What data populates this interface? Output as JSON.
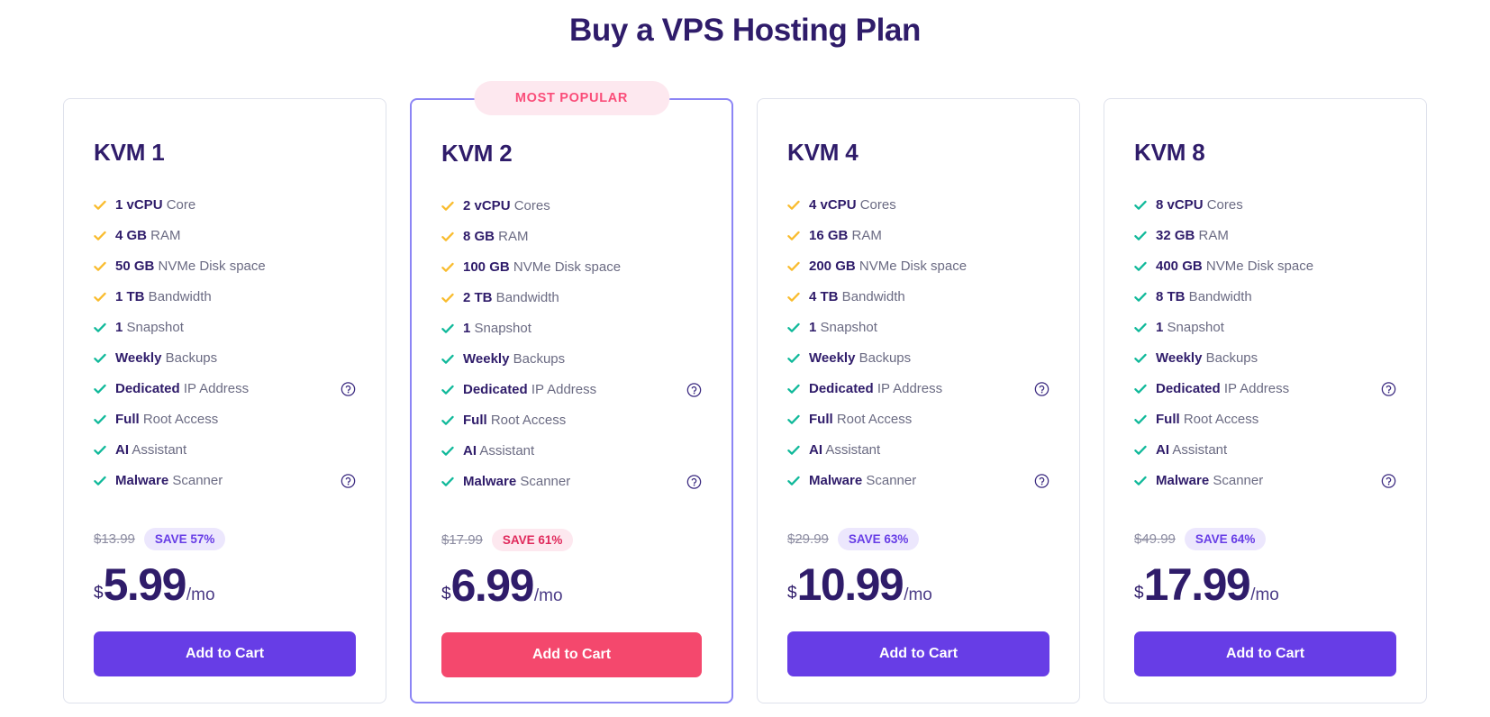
{
  "header": {
    "title": "Buy a VPS Hosting Plan"
  },
  "colors": {
    "title": "#2f1c6a",
    "accent_purple": "#673de6",
    "accent_pink": "#f4486d",
    "check_amber": "#f9bc2e",
    "check_teal": "#10b99a",
    "badge_purple_bg": "#ece7fd",
    "badge_pink_bg": "#fde8ef",
    "card_border": "#dfe2ec",
    "featured_border": "#8c85f5"
  },
  "icons": {
    "check": "check-icon",
    "help": "help-circle-icon"
  },
  "labels": {
    "add_to_cart": "Add to Cart",
    "most_popular": "MOST POPULAR",
    "currency_symbol": "$",
    "period": "/mo"
  },
  "plans": [
    {
      "name": "KVM 1",
      "featured": false,
      "badge": null,
      "features": [
        {
          "strong": "1 vCPU",
          "rest": " Core",
          "check": "amber",
          "help": false
        },
        {
          "strong": "4 GB",
          "rest": " RAM",
          "check": "amber",
          "help": false
        },
        {
          "strong": "50 GB",
          "rest": " NVMe Disk space",
          "check": "amber",
          "help": false
        },
        {
          "strong": "1 TB",
          "rest": " Bandwidth",
          "check": "amber",
          "help": false
        },
        {
          "strong": "1",
          "rest": " Snapshot",
          "check": "teal",
          "help": false
        },
        {
          "strong": "Weekly",
          "rest": " Backups",
          "check": "teal",
          "help": false
        },
        {
          "strong": "Dedicated",
          "rest": " IP Address",
          "check": "teal",
          "help": true
        },
        {
          "strong": "Full",
          "rest": " Root Access",
          "check": "teal",
          "help": false
        },
        {
          "strong": "AI",
          "rest": " Assistant",
          "check": "teal",
          "help": false
        },
        {
          "strong": "Malware",
          "rest": " Scanner",
          "check": "teal",
          "help": true
        }
      ],
      "price_old": "$13.99",
      "save": "SAVE 57%",
      "price_now": "5.99",
      "cta": "Add to Cart",
      "cta_style": "purple",
      "save_style": "purple"
    },
    {
      "name": "KVM 2",
      "featured": true,
      "badge": "MOST POPULAR",
      "features": [
        {
          "strong": "2 vCPU",
          "rest": " Cores",
          "check": "amber",
          "help": false
        },
        {
          "strong": "8 GB",
          "rest": " RAM",
          "check": "amber",
          "help": false
        },
        {
          "strong": "100 GB",
          "rest": " NVMe Disk space",
          "check": "amber",
          "help": false
        },
        {
          "strong": "2 TB",
          "rest": " Bandwidth",
          "check": "amber",
          "help": false
        },
        {
          "strong": "1",
          "rest": " Snapshot",
          "check": "teal",
          "help": false
        },
        {
          "strong": "Weekly",
          "rest": " Backups",
          "check": "teal",
          "help": false
        },
        {
          "strong": "Dedicated",
          "rest": " IP Address",
          "check": "teal",
          "help": true
        },
        {
          "strong": "Full",
          "rest": " Root Access",
          "check": "teal",
          "help": false
        },
        {
          "strong": "AI",
          "rest": " Assistant",
          "check": "teal",
          "help": false
        },
        {
          "strong": "Malware",
          "rest": " Scanner",
          "check": "teal",
          "help": true
        }
      ],
      "price_old": "$17.99",
      "save": "SAVE 61%",
      "price_now": "6.99",
      "cta": "Add to Cart",
      "cta_style": "pink",
      "save_style": "pink"
    },
    {
      "name": "KVM 4",
      "featured": false,
      "badge": null,
      "features": [
        {
          "strong": "4 vCPU",
          "rest": " Cores",
          "check": "amber",
          "help": false
        },
        {
          "strong": "16 GB",
          "rest": " RAM",
          "check": "amber",
          "help": false
        },
        {
          "strong": "200 GB",
          "rest": " NVMe Disk space",
          "check": "amber",
          "help": false
        },
        {
          "strong": "4 TB",
          "rest": " Bandwidth",
          "check": "amber",
          "help": false
        },
        {
          "strong": "1",
          "rest": " Snapshot",
          "check": "teal",
          "help": false
        },
        {
          "strong": "Weekly",
          "rest": " Backups",
          "check": "teal",
          "help": false
        },
        {
          "strong": "Dedicated",
          "rest": " IP Address",
          "check": "teal",
          "help": true
        },
        {
          "strong": "Full",
          "rest": " Root Access",
          "check": "teal",
          "help": false
        },
        {
          "strong": "AI",
          "rest": " Assistant",
          "check": "teal",
          "help": false
        },
        {
          "strong": "Malware",
          "rest": " Scanner",
          "check": "teal",
          "help": true
        }
      ],
      "price_old": "$29.99",
      "save": "SAVE 63%",
      "price_now": "10.99",
      "cta": "Add to Cart",
      "cta_style": "purple",
      "save_style": "purple"
    },
    {
      "name": "KVM 8",
      "featured": false,
      "badge": null,
      "features": [
        {
          "strong": "8 vCPU",
          "rest": " Cores",
          "check": "teal",
          "help": false
        },
        {
          "strong": "32 GB",
          "rest": " RAM",
          "check": "teal",
          "help": false
        },
        {
          "strong": "400 GB",
          "rest": " NVMe Disk space",
          "check": "teal",
          "help": false
        },
        {
          "strong": "8 TB",
          "rest": " Bandwidth",
          "check": "teal",
          "help": false
        },
        {
          "strong": "1",
          "rest": " Snapshot",
          "check": "teal",
          "help": false
        },
        {
          "strong": "Weekly",
          "rest": " Backups",
          "check": "teal",
          "help": false
        },
        {
          "strong": "Dedicated",
          "rest": " IP Address",
          "check": "teal",
          "help": true
        },
        {
          "strong": "Full",
          "rest": " Root Access",
          "check": "teal",
          "help": false
        },
        {
          "strong": "AI",
          "rest": " Assistant",
          "check": "teal",
          "help": false
        },
        {
          "strong": "Malware",
          "rest": " Scanner",
          "check": "teal",
          "help": true
        }
      ],
      "price_old": "$49.99",
      "save": "SAVE 64%",
      "price_now": "17.99",
      "cta": "Add to Cart",
      "cta_style": "purple",
      "save_style": "purple"
    }
  ]
}
